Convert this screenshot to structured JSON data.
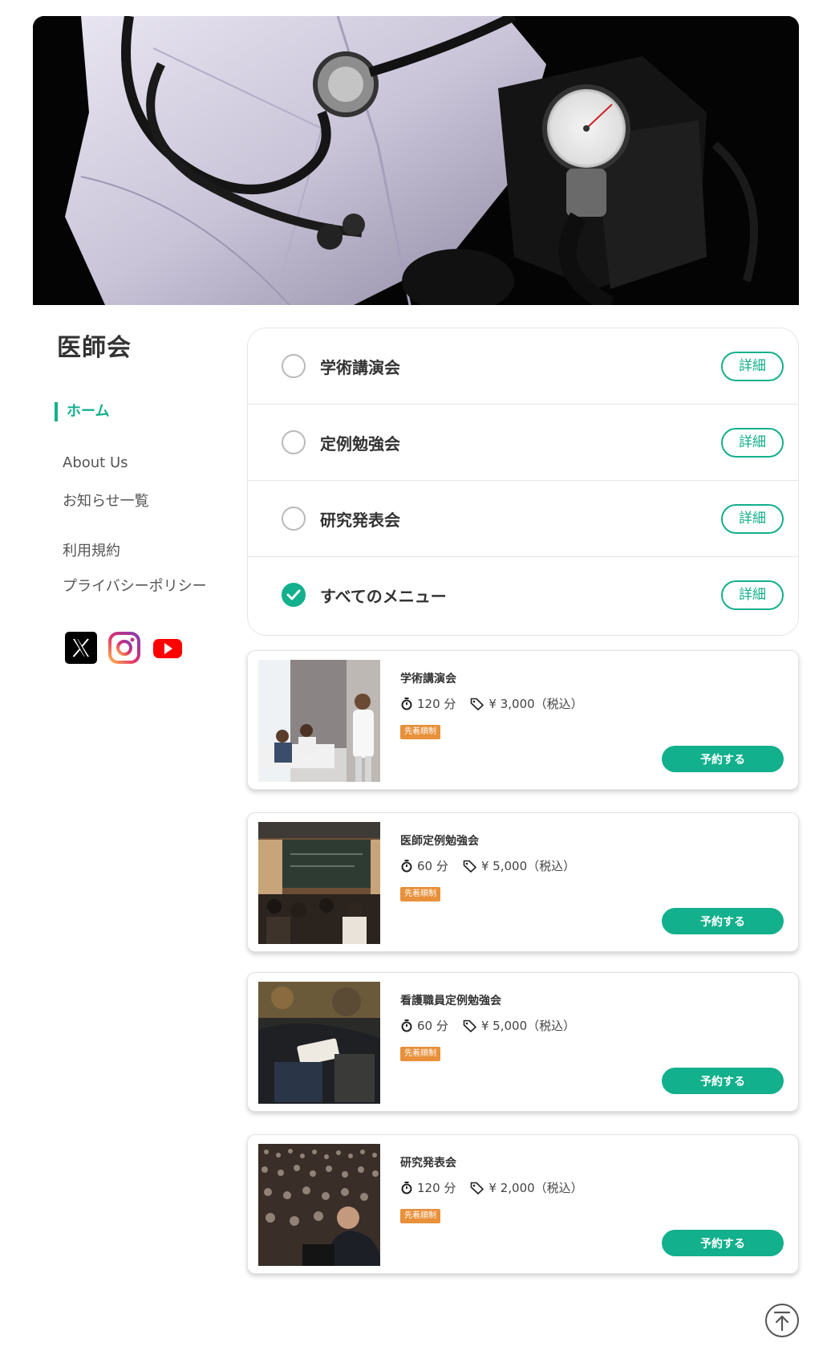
{
  "site": {
    "title": "医師会"
  },
  "sidebar": {
    "nav": [
      {
        "label": "ホーム",
        "active": true
      },
      {
        "label": "About Us"
      },
      {
        "label": "お知らせ一覧"
      },
      {
        "label": "利用規約"
      },
      {
        "label": "プライバシーポリシー"
      }
    ],
    "social": [
      {
        "icon": "x-icon"
      },
      {
        "icon": "instagram-icon"
      },
      {
        "icon": "youtube-icon"
      }
    ]
  },
  "menu": {
    "detail_label": "詳細",
    "items": [
      {
        "label": "学術講演会",
        "checked": false
      },
      {
        "label": "定例勉強会",
        "checked": false
      },
      {
        "label": "研究発表会",
        "checked": false
      },
      {
        "label": "すべてのメニュー",
        "checked": true
      }
    ]
  },
  "courses": [
    {
      "title": "学術講演会",
      "duration": "120 分",
      "price": "¥ 3,000（税込）",
      "badge": "先着順制",
      "button": "予約する"
    },
    {
      "title": "医師定例勉強会",
      "duration": "60 分",
      "price": "¥ 5,000（税込）",
      "badge": "先着順制",
      "button": "予約する"
    },
    {
      "title": "看護職員定例勉強会",
      "duration": "60 分",
      "price": "¥ 5,000（税込）",
      "badge": "先着順制",
      "button": "予約する"
    },
    {
      "title": "研究発表会",
      "duration": "120 分",
      "price": "¥ 2,000（税込）",
      "badge": "先着順制",
      "button": "予約する"
    }
  ],
  "colors": {
    "accent": "#12b08c",
    "badge": "#e8903a"
  }
}
